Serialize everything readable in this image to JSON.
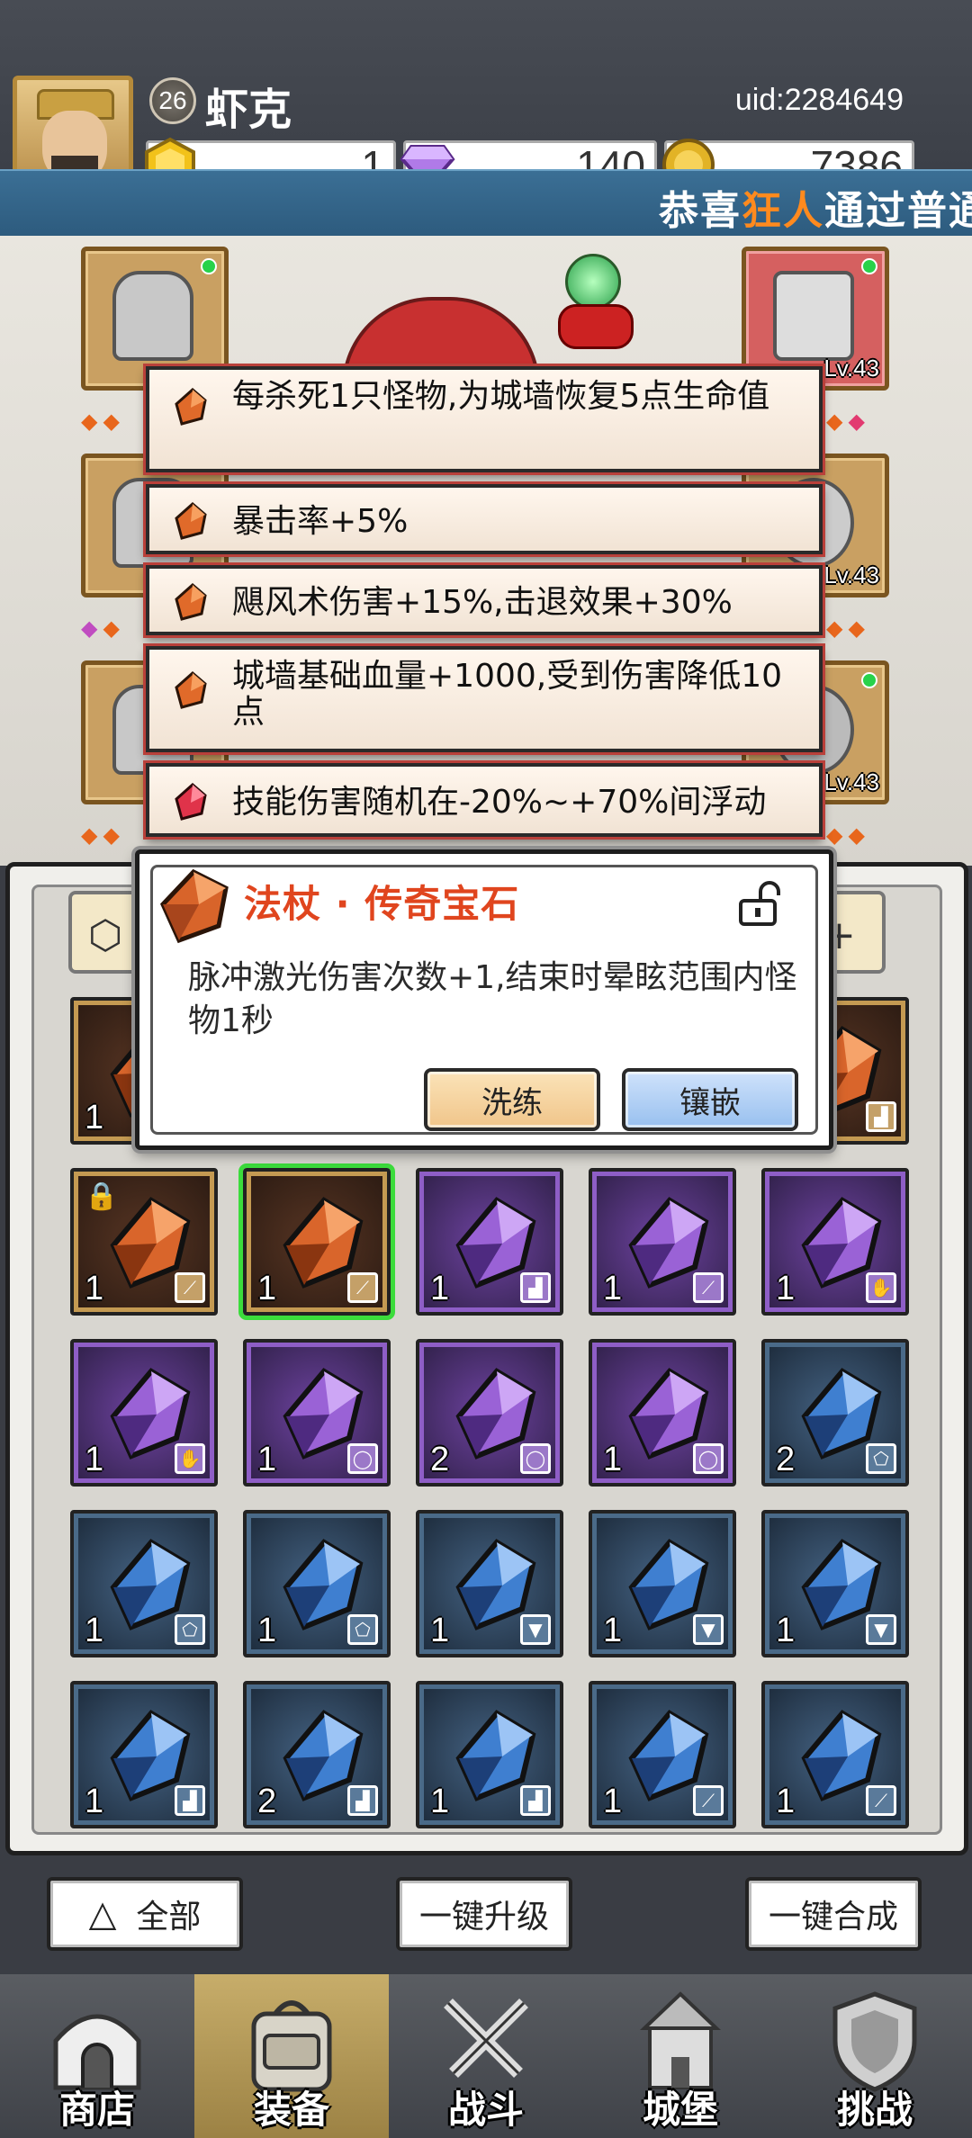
{
  "player": {
    "level": "26",
    "name": "虾克",
    "uid": "uid:2284649"
  },
  "resources": [
    {
      "icon": "gold-gem-icon",
      "value": "1"
    },
    {
      "icon": "purple-diamond-icon",
      "value": "140"
    },
    {
      "icon": "coin-icon",
      "value": "7386"
    }
  ],
  "broadcast": {
    "prefix": "恭喜",
    "highlight": "狂人",
    "suffix": "通过普通"
  },
  "equipment": {
    "levels": [
      "Lv.43",
      "Lv.43",
      "Lv.43"
    ]
  },
  "attributes": [
    "每杀死1只怪物,为城墙恢复5点生命值",
    "暴击率+5%",
    "飓风术伤害+15%,击退效果+30%",
    "城墙基础血量+1000,受到伤害降低10点",
    "技能伤害随机在-20%~+70%间浮动"
  ],
  "tooltip": {
    "title": "法杖 · 传奇宝石",
    "description": "脉冲激光伤害次数+1,结束时晕眩范围内怪物1秒",
    "wash_label": "洗练",
    "inlay_label": "镶嵌"
  },
  "inventory": {
    "rows": [
      [
        {
          "color": "orange",
          "count": "1",
          "slot": "boot-icon"
        },
        {
          "color": "orange",
          "count": "",
          "slot": ""
        },
        {
          "color": "orange",
          "count": "",
          "slot": ""
        },
        {
          "color": "orange",
          "count": "",
          "slot": ""
        },
        {
          "color": "orange",
          "count": "",
          "slot": "boot-icon"
        }
      ],
      [
        {
          "color": "orange",
          "count": "1",
          "slot": "staff-icon",
          "locked": true
        },
        {
          "color": "orange",
          "count": "1",
          "slot": "staff-icon",
          "selected": true
        },
        {
          "color": "purple",
          "count": "1",
          "slot": "boot-icon"
        },
        {
          "color": "purple",
          "count": "1",
          "slot": "staff-icon"
        },
        {
          "color": "purple",
          "count": "1",
          "slot": "gauntlet-icon"
        }
      ],
      [
        {
          "color": "purple",
          "count": "1",
          "slot": "gauntlet-icon"
        },
        {
          "color": "purple",
          "count": "1",
          "slot": "ring-icon"
        },
        {
          "color": "purple",
          "count": "2",
          "slot": "ring-icon"
        },
        {
          "color": "purple",
          "count": "1",
          "slot": "ring-icon"
        },
        {
          "color": "blue",
          "count": "2",
          "slot": "shield-icon"
        }
      ],
      [
        {
          "color": "blue",
          "count": "1",
          "slot": "shield-icon"
        },
        {
          "color": "blue",
          "count": "1",
          "slot": "shield-icon"
        },
        {
          "color": "blue",
          "count": "1",
          "slot": "armor-icon"
        },
        {
          "color": "blue",
          "count": "1",
          "slot": "armor-icon"
        },
        {
          "color": "blue",
          "count": "1",
          "slot": "armor-icon"
        }
      ],
      [
        {
          "color": "blue",
          "count": "1",
          "slot": "boot-icon"
        },
        {
          "color": "blue",
          "count": "2",
          "slot": "boot-icon"
        },
        {
          "color": "blue",
          "count": "1",
          "slot": "boot-icon"
        },
        {
          "color": "blue",
          "count": "1",
          "slot": "staff-icon"
        },
        {
          "color": "blue",
          "count": "1",
          "slot": "staff-icon"
        }
      ]
    ]
  },
  "actions": {
    "all_label": "全部",
    "upgrade_label": "一键升级",
    "merge_label": "一键合成"
  },
  "nav": [
    {
      "label": "商店",
      "icon": "shop-icon"
    },
    {
      "label": "装备",
      "icon": "backpack-icon",
      "active": true
    },
    {
      "label": "战斗",
      "icon": "crossed-swords-icon"
    },
    {
      "label": "城堡",
      "icon": "castle-icon"
    },
    {
      "label": "挑战",
      "icon": "challenge-shield-icon"
    }
  ],
  "colors": {
    "legend_orange": "#e0451e",
    "rare_purple": "#8e5ec6",
    "blue_gem": "#3f7fd0",
    "selected_green": "#3bdc3b"
  }
}
